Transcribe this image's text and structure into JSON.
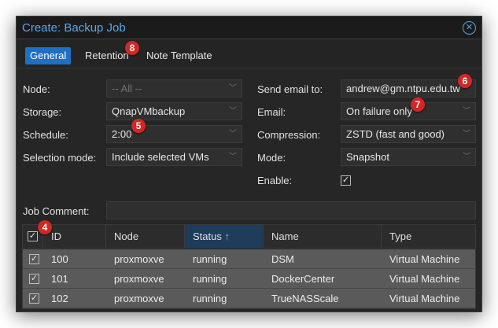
{
  "dialog": {
    "title": "Create: Backup Job",
    "close_icon": "close-circle-icon"
  },
  "tabs": [
    {
      "label": "General",
      "active": true
    },
    {
      "label": "Retention",
      "active": false
    },
    {
      "label": "Note Template",
      "active": false
    }
  ],
  "form": {
    "node": {
      "label": "Node:",
      "value": "-- All --"
    },
    "storage": {
      "label": "Storage:",
      "value": "QnapVMbackup"
    },
    "schedule": {
      "label": "Schedule:",
      "value": "2:00"
    },
    "selection_mode": {
      "label": "Selection mode:",
      "value": "Include selected VMs"
    },
    "send_email": {
      "label": "Send email to:",
      "value": "andrew@gm.ntpu.edu.tw"
    },
    "email": {
      "label": "Email:",
      "value": "On failure only"
    },
    "compression": {
      "label": "Compression:",
      "value": "ZSTD (fast and good)"
    },
    "mode": {
      "label": "Mode:",
      "value": "Snapshot"
    },
    "enable": {
      "label": "Enable:",
      "checked": true
    },
    "job_comment": {
      "label": "Job Comment:",
      "value": ""
    }
  },
  "table": {
    "columns": [
      "ID",
      "Node",
      "Status",
      "Name",
      "Type"
    ],
    "sorted_column": "Status",
    "rows": [
      {
        "checked": true,
        "id": "100",
        "node": "proxmoxve",
        "status": "running",
        "name": "DSM",
        "type": "Virtual Machine"
      },
      {
        "checked": true,
        "id": "101",
        "node": "proxmoxve",
        "status": "running",
        "name": "DockerCenter",
        "type": "Virtual Machine"
      },
      {
        "checked": true,
        "id": "102",
        "node": "proxmoxve",
        "status": "running",
        "name": "TrueNASScale",
        "type": "Virtual Machine"
      }
    ]
  },
  "annotations": [
    "8",
    "6",
    "7",
    "5",
    "4"
  ],
  "colors": {
    "accent": "#1f6fc4",
    "title": "#5aa5e6",
    "badge": "#d32626"
  }
}
